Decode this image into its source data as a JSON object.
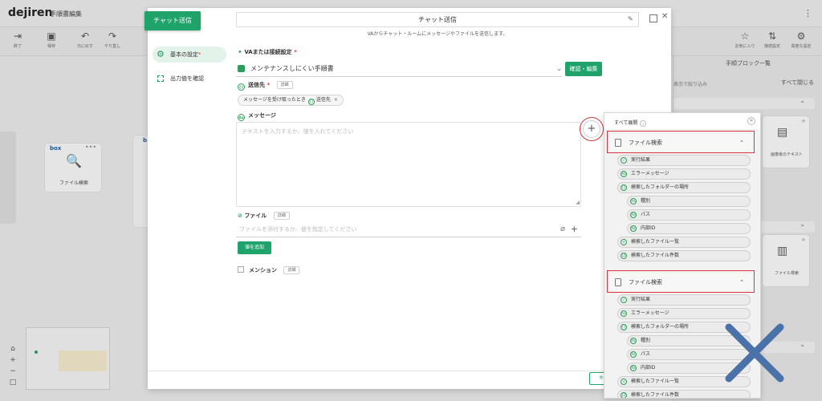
{
  "app": {
    "logo": "dejiren",
    "title": "手順書編集"
  },
  "toolbar": {
    "items": [
      {
        "label": "終了"
      },
      {
        "label": "保存"
      },
      {
        "label": "元に戻す"
      },
      {
        "label": "やり直し"
      },
      {
        "label": "お気に入り"
      },
      {
        "label": "接続設定"
      },
      {
        "label": "高度な設定"
      }
    ]
  },
  "canvas": {
    "node_box_badge": "box",
    "node_label": "ファイル検索",
    "node2_badge": "b"
  },
  "right_panel": {
    "title": "手順ブロック一覧",
    "filter_label": "表示で絞り込み",
    "collapse_all": "すべて閉じる",
    "card1_label": "画像後のテキスト",
    "card2_label": "ファイル検索"
  },
  "modal": {
    "badge": "チャット送信",
    "title": "チャット送信",
    "subtitle": "VAからチャット・ルームにメッセージやファイルを送信します。",
    "nav": [
      {
        "label": "基本の設定",
        "mark": "*"
      },
      {
        "label": "出力値を確認"
      }
    ],
    "va_label": "VAまたは接続設定",
    "required_mark": "*",
    "va_value": "メンテナンスしにくい手順書",
    "confirm_edit": "確認・編集",
    "dest_label": "送信先",
    "detail": "詳細",
    "dest_chip_text": "メッセージを受け取ったとき",
    "dest_chip_var": "送信先",
    "message_label": "メッセージ",
    "message_placeholder": "テキストを入力するか、値を入れてください",
    "file_label": "ファイル",
    "file_placeholder": "ファイルを添付するか、値を指定してください",
    "add_value": "値を追加",
    "mention_label": "メンション",
    "cancel_partial": "キ"
  },
  "picker": {
    "expand_all": "すべて展開",
    "groups": [
      {
        "header": "ファイル検索",
        "items": [
          {
            "label": "実行結果",
            "level": 1
          },
          {
            "label": "エラーメッセージ",
            "level": 1
          },
          {
            "label": "検索したフォルダーの場所",
            "level": 1
          },
          {
            "label": "種別",
            "level": 2
          },
          {
            "label": "パス",
            "level": 2
          },
          {
            "label": "内部ID",
            "level": 2
          },
          {
            "label": "検索したファイル一覧",
            "level": 1
          },
          {
            "label": "検索したファイル件数",
            "level": 1
          }
        ]
      },
      {
        "header": "ファイル検索",
        "items": [
          {
            "label": "実行結果",
            "level": 1
          },
          {
            "label": "エラーメッセージ",
            "level": 1
          },
          {
            "label": "検索したフォルダーの場所",
            "level": 1
          },
          {
            "label": "種別",
            "level": 2
          },
          {
            "label": "パス",
            "level": 2
          },
          {
            "label": "内部ID",
            "level": 2
          },
          {
            "label": "検索したファイル一覧",
            "level": 1
          },
          {
            "label": "検索したファイル件数",
            "level": 1
          }
        ]
      }
    ]
  },
  "colors": {
    "accent": "#1fa36b",
    "highlight": "#d9363e",
    "cross": "#4a72a8"
  }
}
